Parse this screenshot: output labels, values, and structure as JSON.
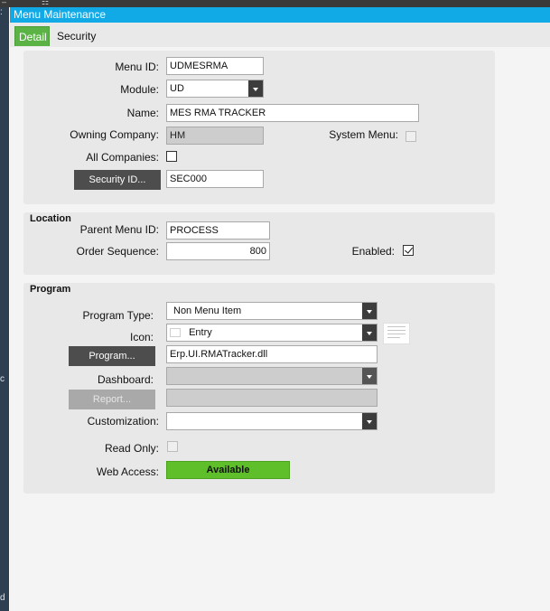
{
  "window": {
    "title": "Menu Maintenance"
  },
  "topbar": {
    "icons": [
      "minimize-icon",
      "grid-icon"
    ]
  },
  "leftstrip": {
    "text_top": ":",
    "text_mid": "c",
    "text_bottom": "d"
  },
  "tabs": [
    {
      "label": "Detail",
      "active": true
    },
    {
      "label": "Security",
      "active": false
    }
  ],
  "detail": {
    "menu_id_label": "Menu ID:",
    "menu_id_value": "UDMESRMA",
    "module_label": "Module:",
    "module_value": "UD",
    "name_label": "Name:",
    "name_value": "MES RMA TRACKER",
    "owning_company_label": "Owning Company:",
    "owning_company_value": "HM",
    "system_menu_label": "System Menu:",
    "system_menu_checked": false,
    "all_companies_label": "All Companies:",
    "all_companies_checked": false,
    "security_id_button": "Security ID...",
    "security_id_value": "SEC000"
  },
  "location": {
    "title": "Location",
    "parent_menu_id_label": "Parent Menu ID:",
    "parent_menu_id_value": "PROCESS",
    "order_sequence_label": "Order Sequence:",
    "order_sequence_value": "800",
    "enabled_label": "Enabled:",
    "enabled_checked": true
  },
  "program": {
    "title": "Program",
    "program_type_label": "Program Type:",
    "program_type_value": "Non Menu Item",
    "icon_label": "Icon:",
    "icon_value": "Entry",
    "program_button": "Program...",
    "program_value": "Erp.UI.RMATracker.dll",
    "dashboard_label": "Dashboard:",
    "dashboard_value": "",
    "report_button": "Report...",
    "report_value": "",
    "customization_label": "Customization:",
    "customization_value": "",
    "read_only_label": "Read Only:",
    "read_only_checked": false,
    "web_access_label": "Web Access:",
    "web_access_value": "Available"
  },
  "colors": {
    "title_bar": "#11a9e6",
    "active_tab": "#5bb346",
    "available": "#5fbf2a",
    "button": "#4d4d4d"
  }
}
